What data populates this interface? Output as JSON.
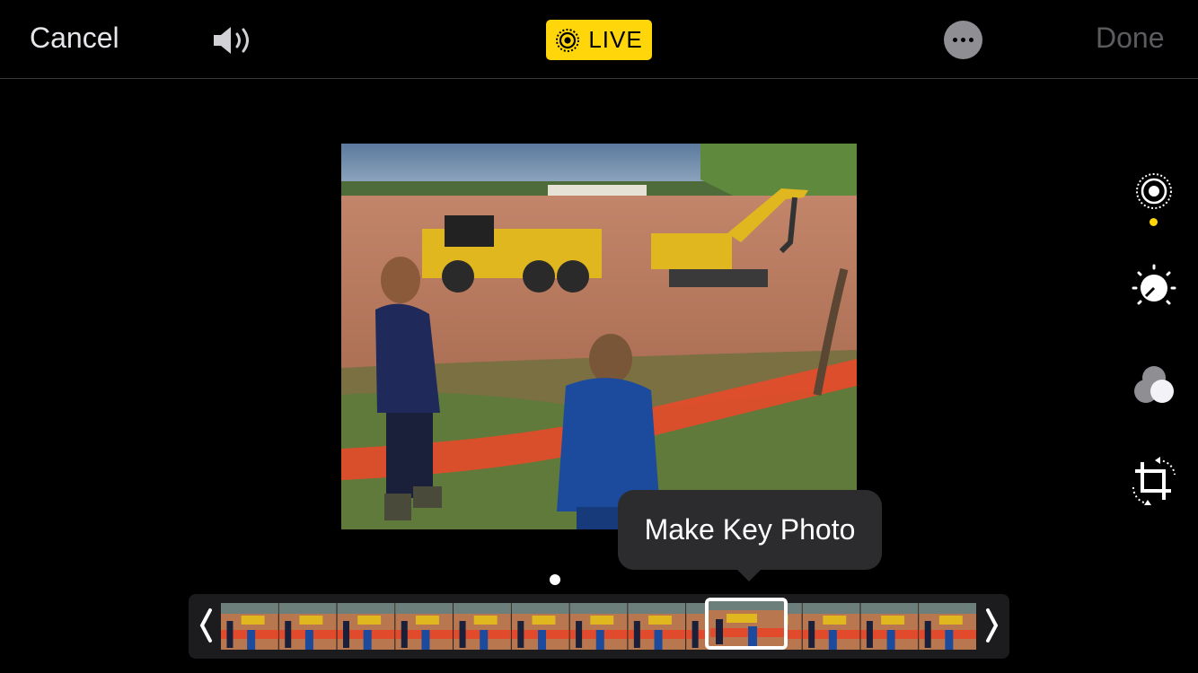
{
  "header": {
    "cancel_label": "Cancel",
    "live_label": "LIVE",
    "done_label": "Done"
  },
  "icons": {
    "sound": "speaker-on-icon",
    "live": "live-photo-icon",
    "more": "more-ellipsis-icon",
    "live_tool": "live-photo-tool-icon",
    "adjust": "adjust-dial-icon",
    "filters": "filters-circles-icon",
    "crop": "crop-rotate-icon",
    "prev": "chevron-left-icon",
    "next": "chevron-right-icon"
  },
  "tooltip": {
    "label": "Make Key Photo"
  },
  "scrubber": {
    "frame_count": 13,
    "selected_frame": 9
  },
  "colors": {
    "accent": "#ffd60a",
    "background": "#000000",
    "done_disabled": "#5c5c60"
  }
}
